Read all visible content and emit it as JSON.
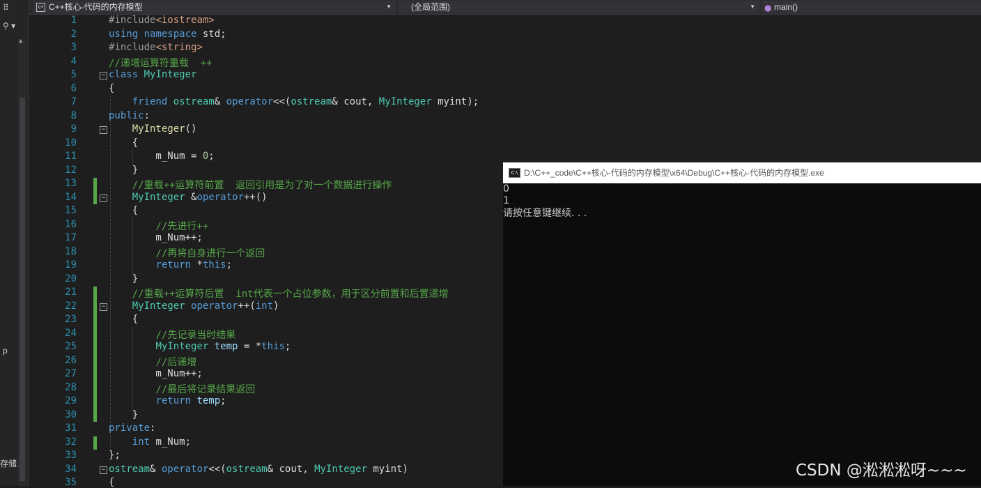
{
  "nav": {
    "file_icon": "cpp-file-icon",
    "file": "C++核心-代码的内存模型",
    "scope": "(全局范围)",
    "func_icon": "method-cube-icon",
    "func": "main()"
  },
  "left_strip": {
    "search_icon": "search-icon",
    "fragment_p": "p",
    "fragment_storage": "存储.c"
  },
  "line_numbers": [
    "1",
    "2",
    "3",
    "4",
    "5",
    "6",
    "7",
    "8",
    "9",
    "10",
    "11",
    "12",
    "13",
    "14",
    "15",
    "16",
    "17",
    "18",
    "19",
    "20",
    "21",
    "22",
    "23",
    "24",
    "25",
    "26",
    "27",
    "28",
    "29",
    "30",
    "31",
    "32",
    "33",
    "34",
    "35"
  ],
  "code": [
    [
      {
        "t": "#include",
        "c": "p"
      },
      {
        "t": "<iostream>",
        "c": "s"
      }
    ],
    [
      {
        "t": "using",
        "c": "k"
      },
      {
        "t": " "
      },
      {
        "t": "namespace",
        "c": "k"
      },
      {
        "t": " std;"
      }
    ],
    [
      {
        "t": "#include",
        "c": "p"
      },
      {
        "t": "<string>",
        "c": "s"
      }
    ],
    [
      {
        "t": "//递增运算符重载  ++",
        "c": "c"
      }
    ],
    [
      {
        "t": "class",
        "c": "k"
      },
      {
        "t": " "
      },
      {
        "t": "MyInteger",
        "c": "t"
      }
    ],
    [
      {
        "t": "{"
      }
    ],
    [
      {
        "t": "    "
      },
      {
        "t": "friend",
        "c": "k"
      },
      {
        "t": " "
      },
      {
        "t": "ostream",
        "c": "t"
      },
      {
        "t": "& "
      },
      {
        "t": "operator",
        "c": "k"
      },
      {
        "t": "<<("
      },
      {
        "t": "ostream",
        "c": "t"
      },
      {
        "t": "& cout, "
      },
      {
        "t": "MyInteger",
        "c": "t"
      },
      {
        "t": " myint);"
      }
    ],
    [
      {
        "t": "public",
        "c": "k"
      },
      {
        "t": ":"
      }
    ],
    [
      {
        "t": "    "
      },
      {
        "t": "MyInteger",
        "c": "f"
      },
      {
        "t": "()"
      }
    ],
    [
      {
        "t": "    {"
      }
    ],
    [
      {
        "t": "        m_Num = "
      },
      {
        "t": "0",
        "c": "n"
      },
      {
        "t": ";"
      }
    ],
    [
      {
        "t": "    }"
      }
    ],
    [
      {
        "t": "    "
      },
      {
        "t": "//重载++运算符前置  返回引用是为了对一个数据进行操作",
        "c": "c"
      }
    ],
    [
      {
        "t": "    "
      },
      {
        "t": "MyInteger",
        "c": "t"
      },
      {
        "t": " &"
      },
      {
        "t": "operator",
        "c": "k"
      },
      {
        "t": "++()"
      }
    ],
    [
      {
        "t": "    {"
      }
    ],
    [
      {
        "t": "        "
      },
      {
        "t": "//先进行++",
        "c": "c"
      }
    ],
    [
      {
        "t": "        m_Num++;"
      }
    ],
    [
      {
        "t": "        "
      },
      {
        "t": "//再将自身进行一个返回",
        "c": "c"
      }
    ],
    [
      {
        "t": "        "
      },
      {
        "t": "return",
        "c": "k"
      },
      {
        "t": " *"
      },
      {
        "t": "this",
        "c": "k"
      },
      {
        "t": ";"
      }
    ],
    [
      {
        "t": "    }"
      }
    ],
    [
      {
        "t": "    "
      },
      {
        "t": "//重载++运算符后置  int代表一个占位参数，用于区分前置和后置递增",
        "c": "c"
      }
    ],
    [
      {
        "t": "    "
      },
      {
        "t": "MyInteger",
        "c": "t"
      },
      {
        "t": " "
      },
      {
        "t": "operator",
        "c": "k"
      },
      {
        "t": "++("
      },
      {
        "t": "int",
        "c": "k"
      },
      {
        "t": ")"
      }
    ],
    [
      {
        "t": "    {"
      }
    ],
    [
      {
        "t": "        "
      },
      {
        "t": "//先记录当时结果",
        "c": "c"
      }
    ],
    [
      {
        "t": "        "
      },
      {
        "t": "MyInteger",
        "c": "t"
      },
      {
        "t": " "
      },
      {
        "t": "temp",
        "c": "v"
      },
      {
        "t": " = *"
      },
      {
        "t": "this",
        "c": "k"
      },
      {
        "t": ";"
      }
    ],
    [
      {
        "t": "        "
      },
      {
        "t": "//后递增",
        "c": "c"
      }
    ],
    [
      {
        "t": "        m_Num++;"
      }
    ],
    [
      {
        "t": "        "
      },
      {
        "t": "//最后将记录结果返回",
        "c": "c"
      }
    ],
    [
      {
        "t": "        "
      },
      {
        "t": "return",
        "c": "k"
      },
      {
        "t": " "
      },
      {
        "t": "temp",
        "c": "v"
      },
      {
        "t": ";"
      }
    ],
    [
      {
        "t": "    }"
      }
    ],
    [
      {
        "t": "private",
        "c": "k"
      },
      {
        "t": ":"
      }
    ],
    [
      {
        "t": "    "
      },
      {
        "t": "int",
        "c": "k"
      },
      {
        "t": " m_Num;"
      }
    ],
    [
      {
        "t": "};"
      }
    ],
    [
      {
        "t": "ostream",
        "c": "t"
      },
      {
        "t": "& "
      },
      {
        "t": "operator",
        "c": "k"
      },
      {
        "t": "<<("
      },
      {
        "t": "ostream",
        "c": "t"
      },
      {
        "t": "& cout, "
      },
      {
        "t": "MyInteger",
        "c": "t"
      },
      {
        "t": " myint)"
      }
    ],
    [
      {
        "t": "{"
      }
    ]
  ],
  "console": {
    "icon": "console-app-icon",
    "title": "D:\\C++_code\\C++核心-代码的内存模型\\x64\\Debug\\C++核心-代码的内存模型.exe",
    "lines": [
      "0",
      "1",
      "请按任意键继续. . ."
    ]
  },
  "watermark": "CSDN @淞淞淞呀~~~"
}
